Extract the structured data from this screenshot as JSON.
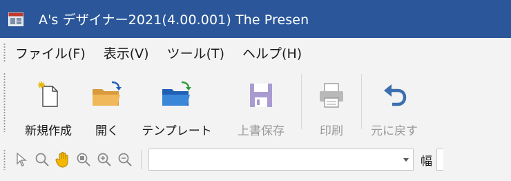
{
  "window": {
    "title": "A's デザイナー2021(4.00.001) The Presen",
    "app_icon": "app-window-icon",
    "accent_color": "#2b579a"
  },
  "menubar": {
    "items": [
      {
        "label": "ファイル(F)"
      },
      {
        "label": "表示(V)"
      },
      {
        "label": "ツール(T)"
      },
      {
        "label": "ヘルプ(H)"
      }
    ]
  },
  "toolbar": {
    "buttons": [
      {
        "label": "新規作成",
        "icon": "new-document-icon",
        "enabled": true
      },
      {
        "label": "開く",
        "icon": "open-folder-icon",
        "enabled": true
      },
      {
        "label": "テンプレート",
        "icon": "template-folder-icon",
        "enabled": true
      },
      {
        "label": "上書保存",
        "icon": "save-icon",
        "enabled": false
      },
      {
        "label": "印刷",
        "icon": "print-icon",
        "enabled": false
      },
      {
        "label": "元に戻す",
        "icon": "undo-icon",
        "enabled": true
      }
    ]
  },
  "toolbar2": {
    "tools": [
      {
        "icon": "pointer-icon"
      },
      {
        "icon": "search-icon"
      },
      {
        "icon": "hand-icon"
      },
      {
        "icon": "zoom-region-icon"
      },
      {
        "icon": "zoom-in-icon"
      },
      {
        "icon": "zoom-out-icon"
      }
    ],
    "zoom_value": "",
    "width_label": "幅"
  }
}
